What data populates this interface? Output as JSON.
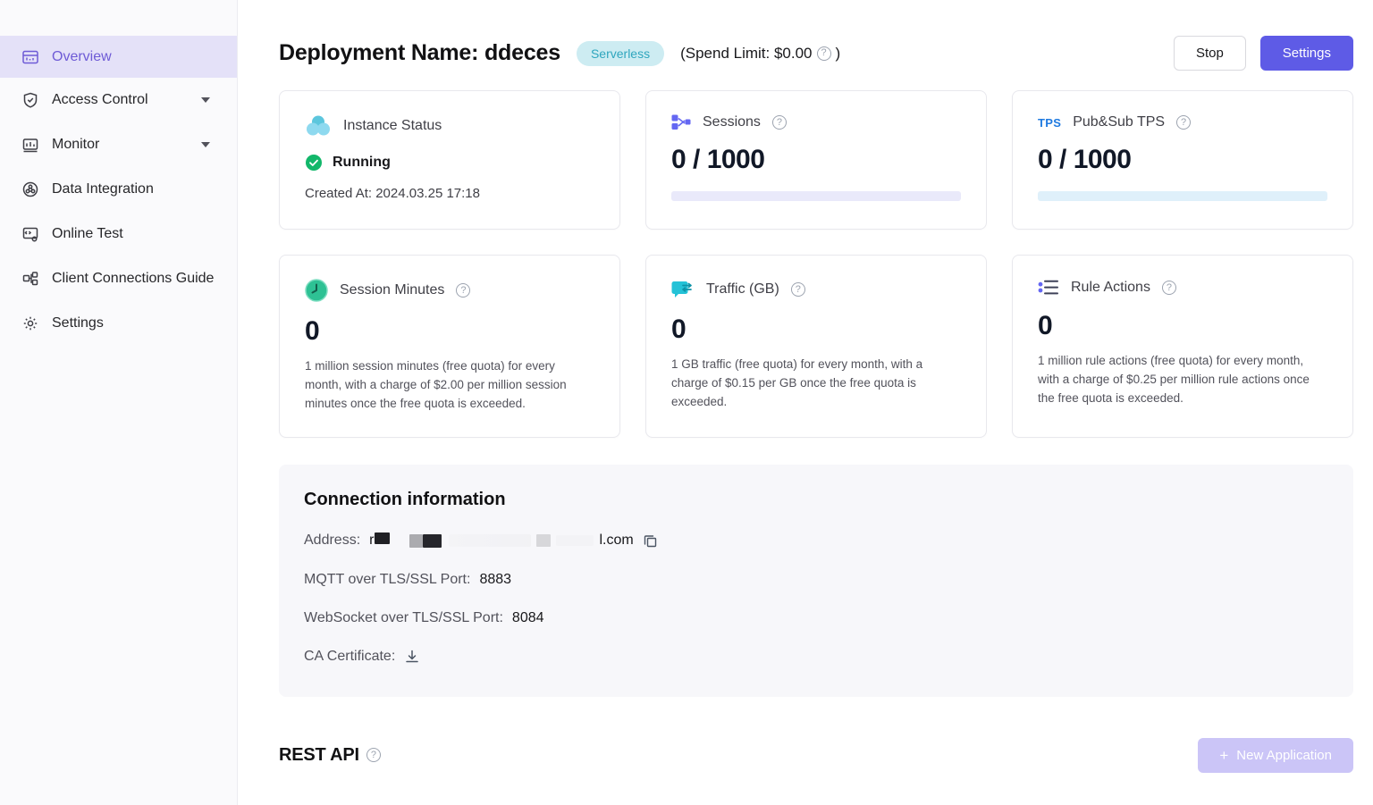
{
  "colors": {
    "accent_purple": "#5e5be6",
    "sidebar_active_bg": "#e4e1f8",
    "sidebar_active_text": "#6e5bd6",
    "badge_bg": "#cdecf2",
    "badge_text": "#2fa6be",
    "success_green": "#12b76a",
    "sessions_bar": "#e9e9fa",
    "tps_bar": "#dff0fa",
    "tps_icon_blue": "#1f7ae0",
    "traffic_teal": "#24c2d7",
    "clock_green": "#2ec194",
    "new_app_disabled_bg": "#cbc5f7"
  },
  "sidebar": {
    "items": [
      {
        "label": "Overview",
        "icon": "overview-icon",
        "active": true
      },
      {
        "label": "Access Control",
        "icon": "access-control-icon",
        "expandable": true
      },
      {
        "label": "Monitor",
        "icon": "monitor-icon",
        "expandable": true
      },
      {
        "label": "Data Integration",
        "icon": "data-integration-icon"
      },
      {
        "label": "Online Test",
        "icon": "online-test-icon"
      },
      {
        "label": "Client Connections Guide",
        "icon": "client-connections-icon"
      },
      {
        "label": "Settings",
        "icon": "settings-icon"
      }
    ]
  },
  "header": {
    "title": "Deployment Name: ddeces",
    "badge": "Serverless",
    "spend_limit_prefix": "(Spend Limit: $0.00",
    "spend_limit_suffix": ")",
    "stop_label": "Stop",
    "settings_label": "Settings"
  },
  "cards": {
    "instance_status": {
      "title": "Instance Status",
      "status": "Running",
      "created_at": "Created At: 2024.03.25 17:18"
    },
    "sessions": {
      "title": "Sessions",
      "value": "0 / 1000"
    },
    "pubsub_tps": {
      "title": "Pub&Sub TPS",
      "icon_text": "TPS",
      "value": "0 / 1000"
    },
    "session_minutes": {
      "title": "Session Minutes",
      "value": "0",
      "description": "1 million session minutes (free quota) for every month, with a charge of $2.00 per million session minutes once the free quota is exceeded."
    },
    "traffic": {
      "title": "Traffic (GB)",
      "value": "0",
      "description": "1 GB traffic (free quota) for every month, with a charge of $0.15 per GB once the free quota is exceeded."
    },
    "rule_actions": {
      "title": "Rule Actions",
      "value": "0",
      "description": "1 million rule actions (free quota) for every month, with a charge of $0.25 per million rule actions once the free quota is exceeded."
    }
  },
  "connection": {
    "title": "Connection information",
    "address_label": "Address:",
    "address_prefix": "r",
    "address_suffix": "l.com",
    "mqtt_label": "MQTT over TLS/SSL Port:",
    "mqtt_value": "8883",
    "ws_label": "WebSocket over TLS/SSL Port:",
    "ws_value": "8084",
    "ca_label": "CA Certificate:"
  },
  "rest_api": {
    "title": "REST API",
    "plus": "+",
    "new_application_label": "New Application"
  },
  "help_glyph": "?"
}
